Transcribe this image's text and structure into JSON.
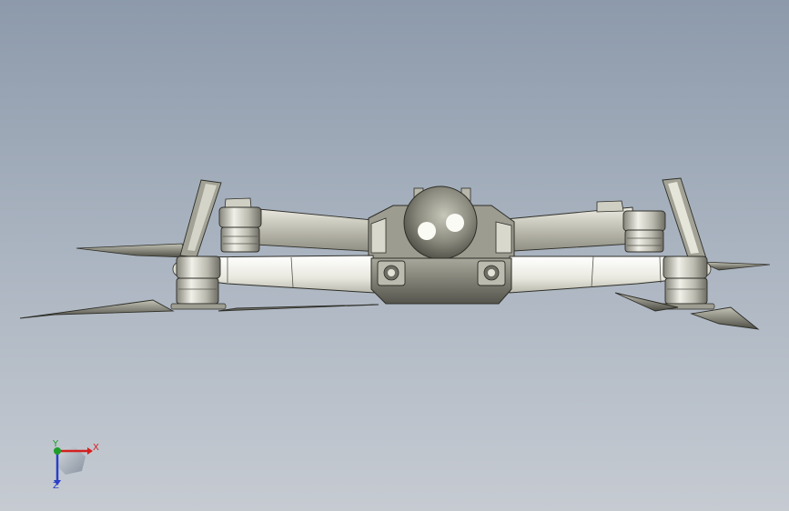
{
  "viewport": {
    "background_top": "#8d9aab",
    "background_bottom": "#c6cbd2",
    "model": "drone-assembly"
  },
  "triad": {
    "x_label": "X",
    "y_label": "Y",
    "z_label": "Z",
    "x_color": "#d42020",
    "y_color": "#1d9e2a",
    "z_color": "#2b3fc8"
  }
}
